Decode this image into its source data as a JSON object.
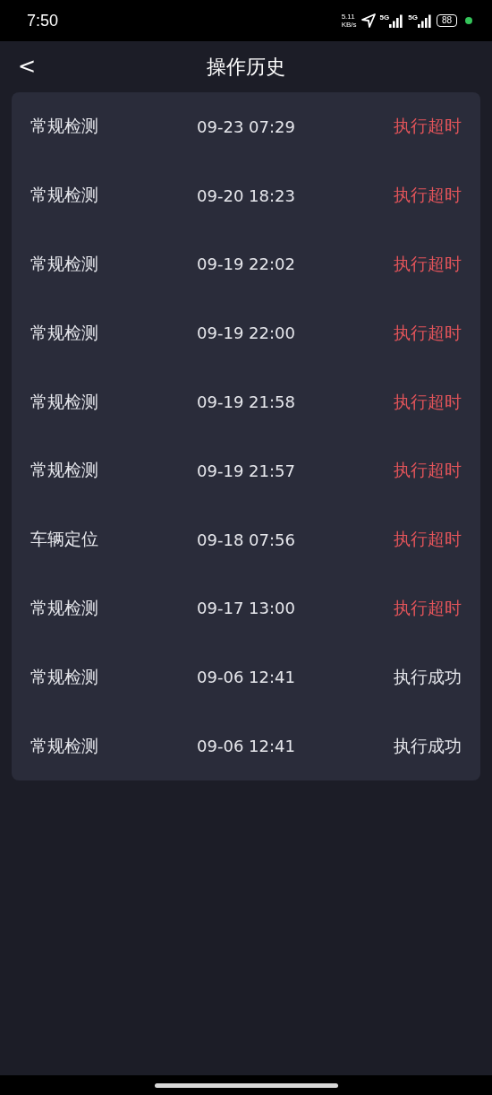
{
  "status_bar": {
    "time": "7:50",
    "net_speed": "5.11",
    "net_unit": "KB/s",
    "sim1": "5G",
    "sim2": "5G",
    "battery": "88"
  },
  "header": {
    "back": "<",
    "title": "操作历史"
  },
  "records": [
    {
      "name": "常规检测",
      "time": "09-23 07:29",
      "result": "执行超时",
      "kind": "timeout"
    },
    {
      "name": "常规检测",
      "time": "09-20 18:23",
      "result": "执行超时",
      "kind": "timeout"
    },
    {
      "name": "常规检测",
      "time": "09-19 22:02",
      "result": "执行超时",
      "kind": "timeout"
    },
    {
      "name": "常规检测",
      "time": "09-19 22:00",
      "result": "执行超时",
      "kind": "timeout"
    },
    {
      "name": "常规检测",
      "time": "09-19 21:58",
      "result": "执行超时",
      "kind": "timeout"
    },
    {
      "name": "常规检测",
      "time": "09-19 21:57",
      "result": "执行超时",
      "kind": "timeout"
    },
    {
      "name": "车辆定位",
      "time": "09-18 07:56",
      "result": "执行超时",
      "kind": "timeout"
    },
    {
      "name": "常规检测",
      "time": "09-17 13:00",
      "result": "执行超时",
      "kind": "timeout"
    },
    {
      "name": "常规检测",
      "time": "09-06 12:41",
      "result": "执行成功",
      "kind": "success"
    },
    {
      "name": "常规检测",
      "time": "09-06 12:41",
      "result": "执行成功",
      "kind": "success"
    }
  ]
}
